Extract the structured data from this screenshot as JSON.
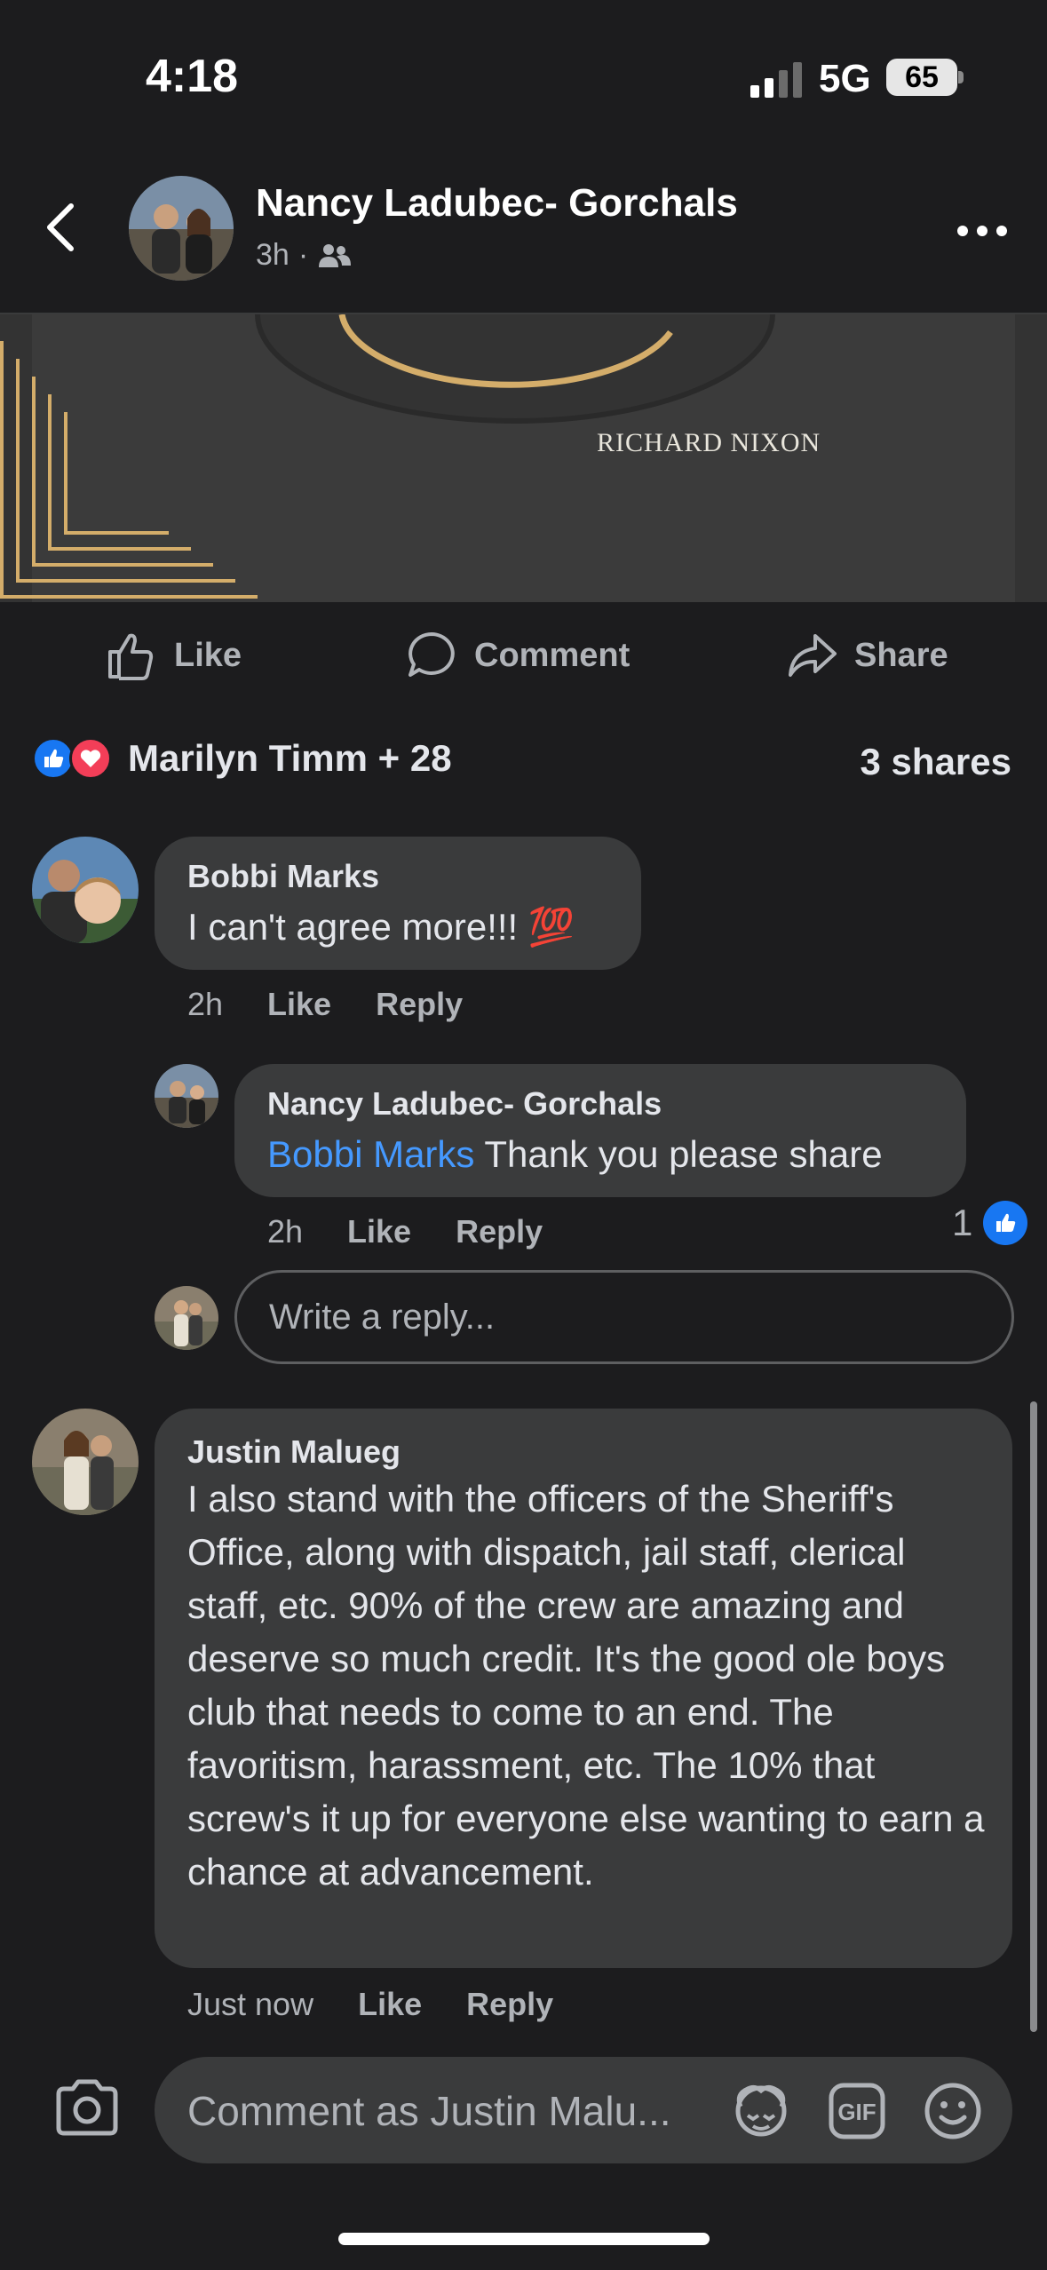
{
  "status_bar": {
    "time": "4:18",
    "network": "5G",
    "battery": "65"
  },
  "header": {
    "back_icon": "chevron-left-icon",
    "author": "Nancy Ladubec- Gorchals",
    "time": "3h",
    "separator": "·",
    "audience_icon": "friends-icon",
    "more_icon": "more-horizontal-icon"
  },
  "post_image": {
    "quote_author": "RICHARD NIXON"
  },
  "actions": {
    "like": "Like",
    "comment": "Comment",
    "share": "Share"
  },
  "reactions": {
    "names": "Marilyn Timm + 28",
    "shares": "3 shares"
  },
  "comments": [
    {
      "name": "Bobbi Marks",
      "text": "I can't agree more!!! 💯",
      "time": "2h",
      "like": "Like",
      "reply": "Reply",
      "replies": [
        {
          "name": "Nancy Ladubec- Gorchals",
          "mention": "Bobbi Marks",
          "text": " Thank you please share",
          "time": "2h",
          "like": "Like",
          "reply": "Reply",
          "likes": "1"
        }
      ],
      "reply_placeholder": "Write a reply..."
    },
    {
      "name": "Justin Malueg",
      "text": "I also stand with the officers of the Sheriff's Office, along with dispatch, jail staff, clerical staff, etc. 90% of the crew are amazing and deserve so much credit. It's the good ole boys club that needs to come to an end. The favoritism, harassment, etc. The 10% that screw's it up for everyone else wanting to earn a chance at advancement.",
      "time": "Just now",
      "like": "Like",
      "reply": "Reply"
    }
  ],
  "composer": {
    "placeholder": "Comment as Justin Malu...",
    "icons": [
      "camera-icon",
      "avatar-sticker-icon",
      "gif-icon",
      "emoji-icon"
    ]
  },
  "colors": {
    "background": "#1c1c1e",
    "bubble": "#3a3b3c",
    "mention": "#4599ff",
    "like_blue": "#1877f2",
    "love_red": "#f33e58"
  }
}
